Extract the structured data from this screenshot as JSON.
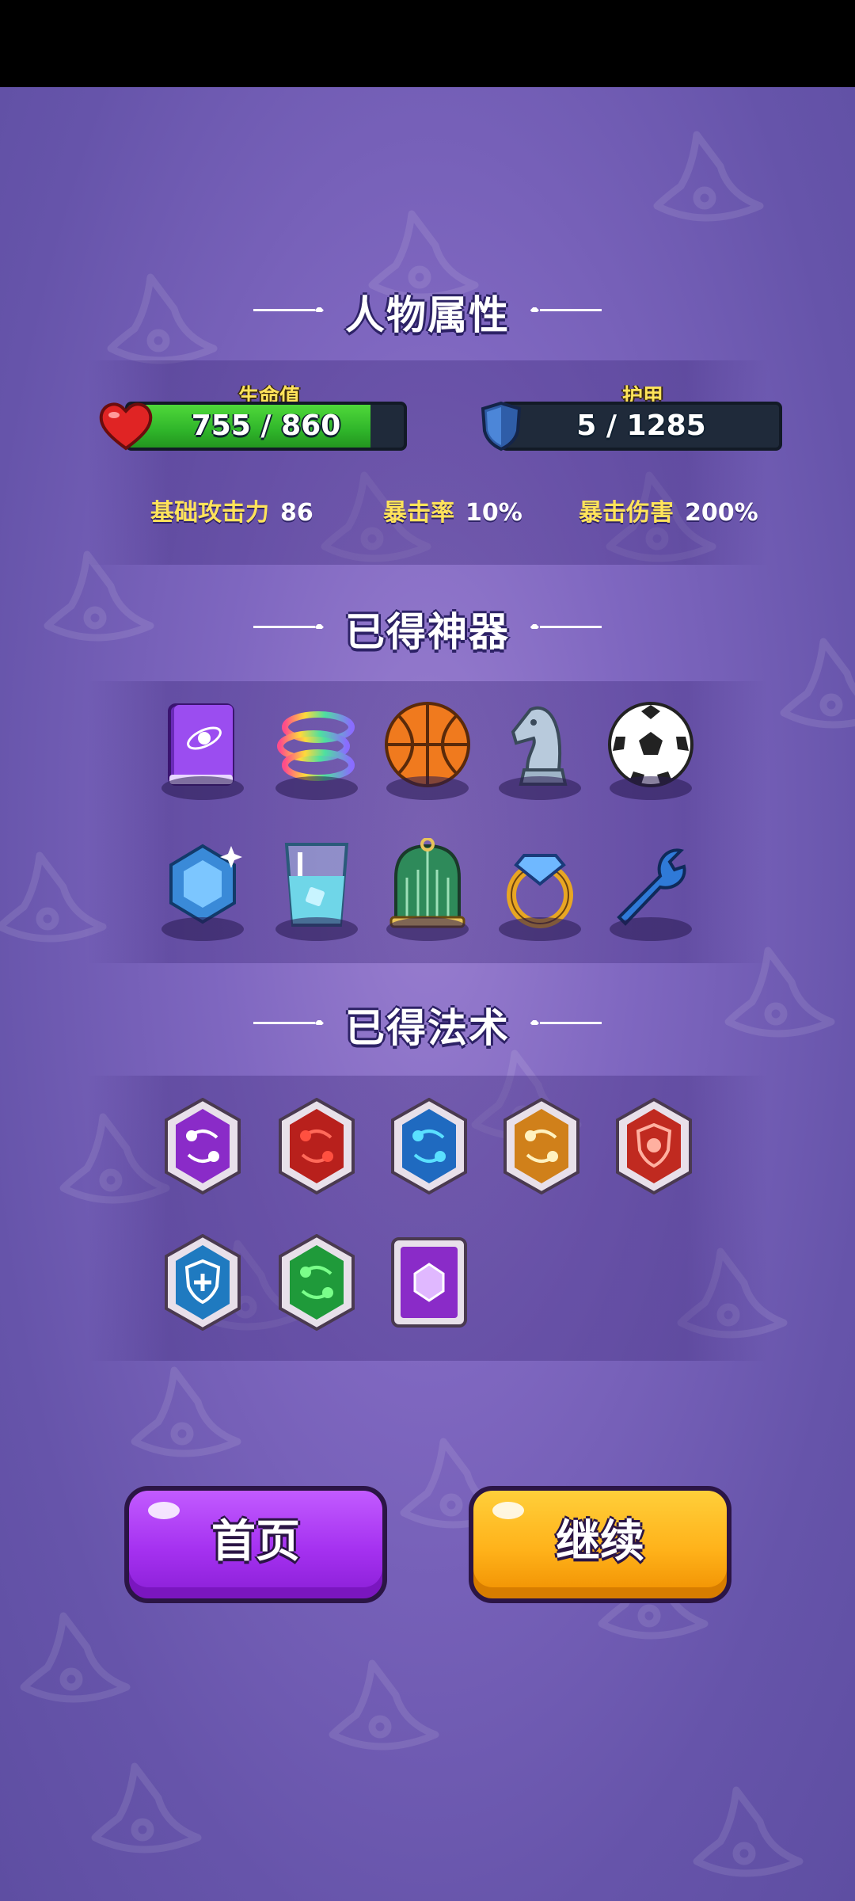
{
  "sections": {
    "attributes_title": "人物属性",
    "artifacts_title": "已得神器",
    "spells_title": "已得法术"
  },
  "hp": {
    "label": "生命值",
    "value_text": "755 / 860",
    "current": 755,
    "max": 860,
    "color": "#2fb52a"
  },
  "armor": {
    "label": "护甲",
    "value_text": "5 / 1285",
    "current": 5,
    "max": 1285
  },
  "stats": [
    {
      "label": "基础攻击力",
      "value": "86"
    },
    {
      "label": "暴击率",
      "value": "10%"
    },
    {
      "label": "暴击伤害",
      "value": "200%"
    }
  ],
  "artifacts": [
    "purple-spellbook-icon",
    "rainbow-rings-icon",
    "basketball-icon",
    "chess-knight-icon",
    "soccer-ball-icon",
    "blue-gem-icon",
    "ice-water-glass-icon",
    "birdcage-icon",
    "diamond-ring-icon",
    "wrench-icon"
  ],
  "spells": [
    "purple-orbit-spell-icon",
    "red-orbit-spell-icon",
    "blue-orbit-spell-icon",
    "orange-orbit-spell-icon",
    "red-shield-spell-icon",
    "blue-heal-shield-spell-icon",
    "green-orbit-spell-icon",
    "purple-gem-spell-icon"
  ],
  "buttons": {
    "home": "首页",
    "continue": "继续"
  },
  "colors": {
    "home_button": "#a531f0",
    "continue_button": "#ffb21a",
    "stat_label": "#ffe35a"
  }
}
